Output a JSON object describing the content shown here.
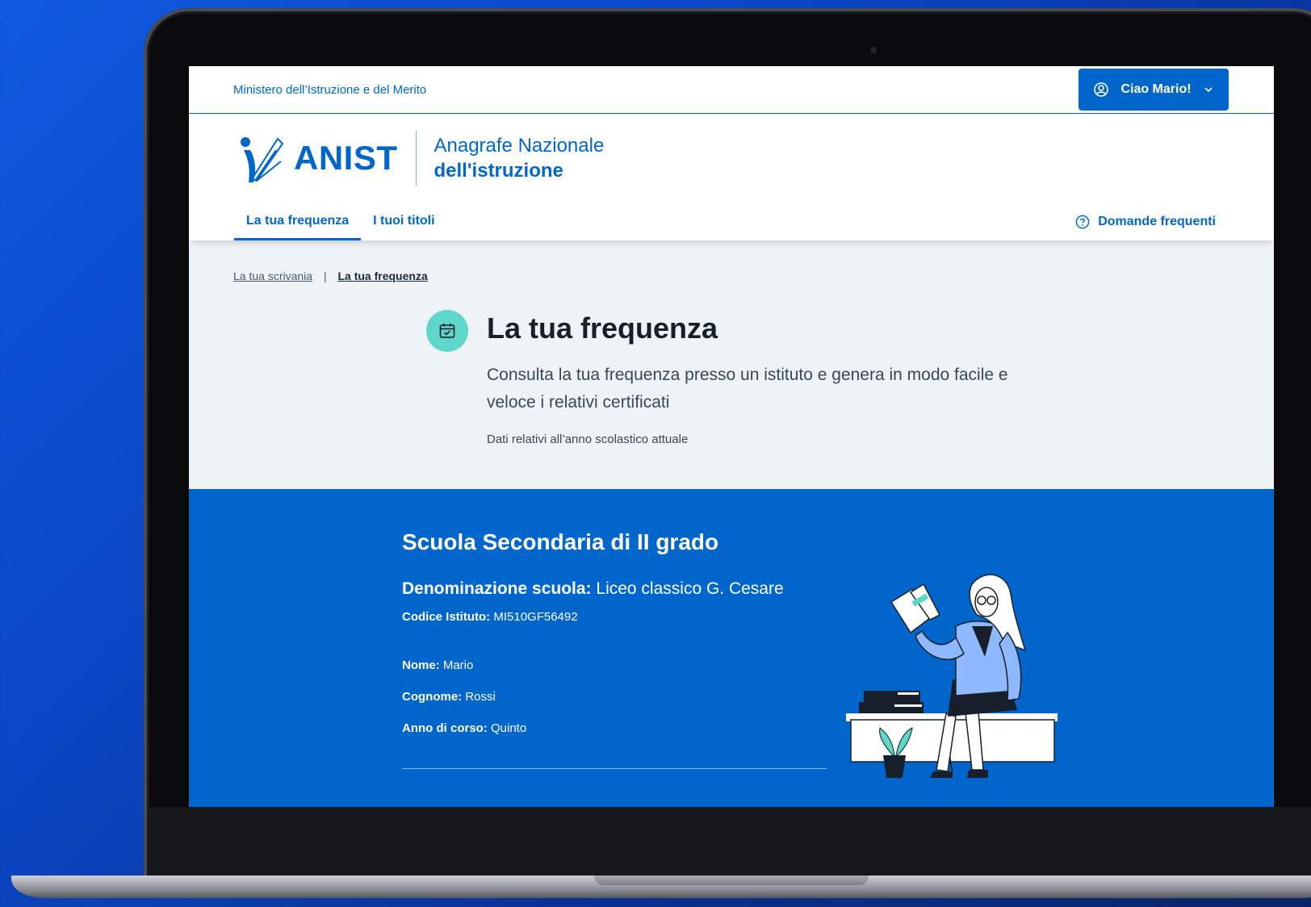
{
  "topbar": {
    "ministry": "Ministero dell’Istruzione e del Merito",
    "user_label": "Ciao Mario!"
  },
  "header": {
    "logo_text": "ANIST",
    "subtitle_line1": "Anagrafe Nazionale",
    "subtitle_line2": "dell'istruzione"
  },
  "nav": {
    "tabs": [
      {
        "label": "La tua frequenza",
        "active": true
      },
      {
        "label": "I tuoi titoli",
        "active": false
      }
    ],
    "faq_label": "Domande frequenti"
  },
  "breadcrumb": {
    "home": "La tua scrivania",
    "separator": "|",
    "current": "La tua frequenza"
  },
  "intro": {
    "title": "La tua frequenza",
    "description": "Consulta la tua frequenza presso un istituto e genera in modo facile e veloce i relativi certificati",
    "note": "Dati relativi all’anno scolastico attuale"
  },
  "school": {
    "title": "Scuola Secondaria di II grado",
    "denomination_label": "Denominazione scuola:",
    "denomination_value": "Liceo classico G. Cesare",
    "code_label": "Codice Istituto:",
    "code_value": "MI510GF56492",
    "first_name_label": "Nome:",
    "first_name_value": "Mario",
    "last_name_label": "Cognome:",
    "last_name_value": "Rossi",
    "year_label": "Anno di corso:",
    "year_value": "Quinto"
  },
  "colors": {
    "primary": "#0066cc",
    "intro_bg": "#eef3f8",
    "icon_bg": "#5ed6c9"
  }
}
